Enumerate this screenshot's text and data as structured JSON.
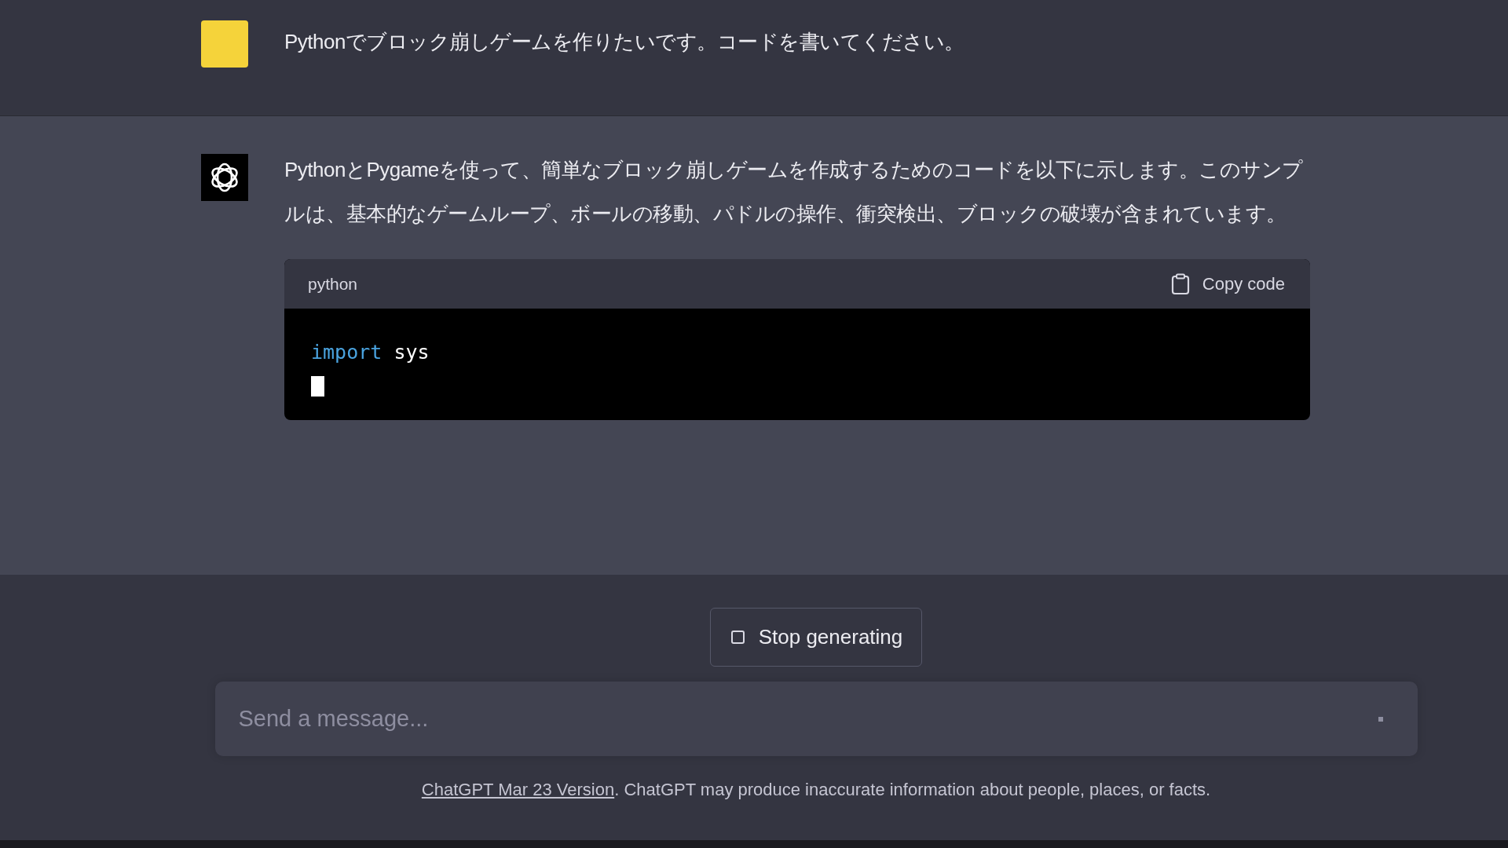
{
  "user_message": {
    "text": "Pythonでブロック崩しゲームを作りたいです。コードを書いてください。"
  },
  "assistant_message": {
    "text": "PythonとPygameを使って、簡単なブロック崩しゲームを作成するためのコードを以下に示します。このサンプルは、基本的なゲームループ、ボールの移動、パドルの操作、衝突検出、ブロックの破壊が含まれています。",
    "code_block": {
      "language": "python",
      "copy_label": "Copy code",
      "lines": [
        [
          {
            "kind": "keyword",
            "text": "import"
          },
          {
            "kind": "plain",
            "text": "sys"
          }
        ]
      ]
    }
  },
  "stop_button": {
    "label": "Stop generating"
  },
  "message_input": {
    "placeholder": "Send a message..."
  },
  "footer": {
    "link": "ChatGPT Mar 23 Version",
    "text": ". ChatGPT may produce inaccurate information about people, places, or facts."
  }
}
